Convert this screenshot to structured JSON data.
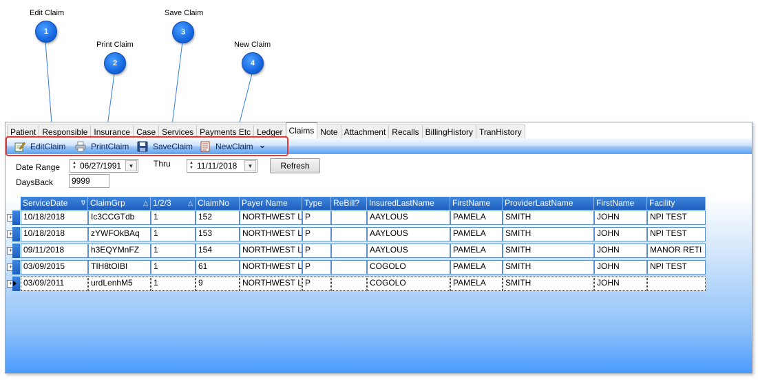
{
  "callouts": [
    {
      "number": "1",
      "label": "Edit Claim"
    },
    {
      "number": "2",
      "label": "Print Claim"
    },
    {
      "number": "3",
      "label": "Save Claim"
    },
    {
      "number": "4",
      "label": "New Claim"
    }
  ],
  "tabs": [
    "Patient",
    "Responsible",
    "Insurance",
    "Case",
    "Services",
    "Payments Etc",
    "Ledger",
    "Claims",
    "Note",
    "Attachment",
    "Recalls",
    "BillingHistory",
    "TranHistory"
  ],
  "active_tab": "Claims",
  "toolbar": {
    "edit_label": "EditClaim",
    "print_label": "PrintClaim",
    "save_label": "SaveClaim",
    "new_label": "NewClaim",
    "overflow_glyph": "⌄"
  },
  "filters": {
    "date_range_label": "Date Range",
    "date_from": "06/27/1991",
    "thru_label": "Thru",
    "date_to": "11/11/2018",
    "refresh_label": "Refresh",
    "days_back_label": "DaysBack",
    "days_back_value": "9999"
  },
  "grid": {
    "columns": [
      "ServiceDate",
      "ClaimGrp",
      "1/2/3",
      "ClaimNo",
      "Payer Name",
      "Type",
      "ReBill?",
      "InsuredLastName",
      "FirstName",
      "ProviderLastName",
      "FirstName",
      "Facility"
    ],
    "sort_glyphs": [
      "∇",
      "△",
      "△",
      "",
      "",
      "",
      "",
      "",
      "",
      "",
      "",
      ""
    ],
    "rows": [
      [
        "10/18/2018",
        "Ic3CCGTdb",
        "1",
        "152",
        "NORTHWEST L",
        "P",
        "",
        "AAYLOUS",
        "PAMELA",
        "SMITH",
        "JOHN",
        "NPI TEST"
      ],
      [
        "10/18/2018",
        "zYWFOkBAq",
        "1",
        "153",
        "NORTHWEST L",
        "P",
        "",
        "AAYLOUS",
        "PAMELA",
        "SMITH",
        "JOHN",
        "NPI TEST"
      ],
      [
        "09/11/2018",
        "h3EQYMnFZ",
        "1",
        "154",
        "NORTHWEST L",
        "P",
        "",
        "AAYLOUS",
        "PAMELA",
        "SMITH",
        "JOHN",
        "MANOR RETI"
      ],
      [
        "03/09/2015",
        "TIH8tOIBI",
        "1",
        "61",
        "NORTHWEST L",
        "P",
        "",
        "COGOLO",
        "PAMELA",
        "SMITH",
        "JOHN",
        "NPI TEST"
      ],
      [
        "03/09/2011",
        "urdLenhM5",
        "1",
        "9",
        "NORTHWEST L",
        "P",
        "",
        "COGOLO",
        "PAMELA",
        "SMITH",
        "JOHN",
        ""
      ]
    ],
    "expander_glyph": "+"
  },
  "colors": {
    "callout_bubble": "#1668e0",
    "highlight_box": "#e53935",
    "grid_header": "#2a6fcf",
    "toolbar_bottom": "#5da3f1"
  }
}
